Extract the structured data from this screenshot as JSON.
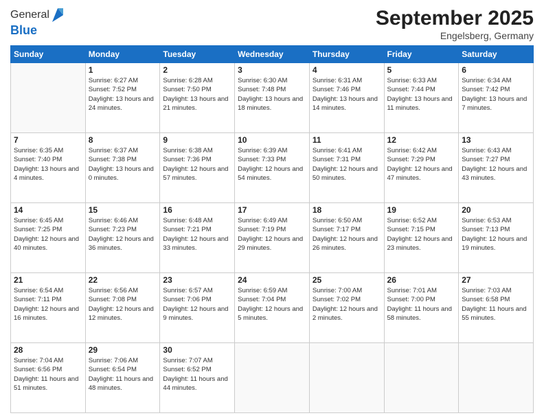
{
  "header": {
    "logo_line1": "General",
    "logo_line2": "Blue",
    "month": "September 2025",
    "location": "Engelsberg, Germany"
  },
  "days_of_week": [
    "Sunday",
    "Monday",
    "Tuesday",
    "Wednesday",
    "Thursday",
    "Friday",
    "Saturday"
  ],
  "weeks": [
    [
      {
        "day": "",
        "info": ""
      },
      {
        "day": "1",
        "info": "Sunrise: 6:27 AM\nSunset: 7:52 PM\nDaylight: 13 hours and 24 minutes."
      },
      {
        "day": "2",
        "info": "Sunrise: 6:28 AM\nSunset: 7:50 PM\nDaylight: 13 hours and 21 minutes."
      },
      {
        "day": "3",
        "info": "Sunrise: 6:30 AM\nSunset: 7:48 PM\nDaylight: 13 hours and 18 minutes."
      },
      {
        "day": "4",
        "info": "Sunrise: 6:31 AM\nSunset: 7:46 PM\nDaylight: 13 hours and 14 minutes."
      },
      {
        "day": "5",
        "info": "Sunrise: 6:33 AM\nSunset: 7:44 PM\nDaylight: 13 hours and 11 minutes."
      },
      {
        "day": "6",
        "info": "Sunrise: 6:34 AM\nSunset: 7:42 PM\nDaylight: 13 hours and 7 minutes."
      }
    ],
    [
      {
        "day": "7",
        "info": "Sunrise: 6:35 AM\nSunset: 7:40 PM\nDaylight: 13 hours and 4 minutes."
      },
      {
        "day": "8",
        "info": "Sunrise: 6:37 AM\nSunset: 7:38 PM\nDaylight: 13 hours and 0 minutes."
      },
      {
        "day": "9",
        "info": "Sunrise: 6:38 AM\nSunset: 7:36 PM\nDaylight: 12 hours and 57 minutes."
      },
      {
        "day": "10",
        "info": "Sunrise: 6:39 AM\nSunset: 7:33 PM\nDaylight: 12 hours and 54 minutes."
      },
      {
        "day": "11",
        "info": "Sunrise: 6:41 AM\nSunset: 7:31 PM\nDaylight: 12 hours and 50 minutes."
      },
      {
        "day": "12",
        "info": "Sunrise: 6:42 AM\nSunset: 7:29 PM\nDaylight: 12 hours and 47 minutes."
      },
      {
        "day": "13",
        "info": "Sunrise: 6:43 AM\nSunset: 7:27 PM\nDaylight: 12 hours and 43 minutes."
      }
    ],
    [
      {
        "day": "14",
        "info": "Sunrise: 6:45 AM\nSunset: 7:25 PM\nDaylight: 12 hours and 40 minutes."
      },
      {
        "day": "15",
        "info": "Sunrise: 6:46 AM\nSunset: 7:23 PM\nDaylight: 12 hours and 36 minutes."
      },
      {
        "day": "16",
        "info": "Sunrise: 6:48 AM\nSunset: 7:21 PM\nDaylight: 12 hours and 33 minutes."
      },
      {
        "day": "17",
        "info": "Sunrise: 6:49 AM\nSunset: 7:19 PM\nDaylight: 12 hours and 29 minutes."
      },
      {
        "day": "18",
        "info": "Sunrise: 6:50 AM\nSunset: 7:17 PM\nDaylight: 12 hours and 26 minutes."
      },
      {
        "day": "19",
        "info": "Sunrise: 6:52 AM\nSunset: 7:15 PM\nDaylight: 12 hours and 23 minutes."
      },
      {
        "day": "20",
        "info": "Sunrise: 6:53 AM\nSunset: 7:13 PM\nDaylight: 12 hours and 19 minutes."
      }
    ],
    [
      {
        "day": "21",
        "info": "Sunrise: 6:54 AM\nSunset: 7:11 PM\nDaylight: 12 hours and 16 minutes."
      },
      {
        "day": "22",
        "info": "Sunrise: 6:56 AM\nSunset: 7:08 PM\nDaylight: 12 hours and 12 minutes."
      },
      {
        "day": "23",
        "info": "Sunrise: 6:57 AM\nSunset: 7:06 PM\nDaylight: 12 hours and 9 minutes."
      },
      {
        "day": "24",
        "info": "Sunrise: 6:59 AM\nSunset: 7:04 PM\nDaylight: 12 hours and 5 minutes."
      },
      {
        "day": "25",
        "info": "Sunrise: 7:00 AM\nSunset: 7:02 PM\nDaylight: 12 hours and 2 minutes."
      },
      {
        "day": "26",
        "info": "Sunrise: 7:01 AM\nSunset: 7:00 PM\nDaylight: 11 hours and 58 minutes."
      },
      {
        "day": "27",
        "info": "Sunrise: 7:03 AM\nSunset: 6:58 PM\nDaylight: 11 hours and 55 minutes."
      }
    ],
    [
      {
        "day": "28",
        "info": "Sunrise: 7:04 AM\nSunset: 6:56 PM\nDaylight: 11 hours and 51 minutes."
      },
      {
        "day": "29",
        "info": "Sunrise: 7:06 AM\nSunset: 6:54 PM\nDaylight: 11 hours and 48 minutes."
      },
      {
        "day": "30",
        "info": "Sunrise: 7:07 AM\nSunset: 6:52 PM\nDaylight: 11 hours and 44 minutes."
      },
      {
        "day": "",
        "info": ""
      },
      {
        "day": "",
        "info": ""
      },
      {
        "day": "",
        "info": ""
      },
      {
        "day": "",
        "info": ""
      }
    ]
  ]
}
